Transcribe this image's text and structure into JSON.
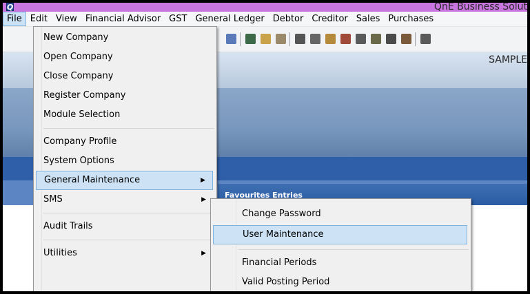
{
  "window": {
    "title": "QnE Business Solut",
    "app_icon_glyph": "Q"
  },
  "menubar": {
    "items": [
      {
        "label": "File",
        "active": true
      },
      {
        "label": "Edit"
      },
      {
        "label": "View"
      },
      {
        "label": "Financial Advisor"
      },
      {
        "label": "GST"
      },
      {
        "label": "General Ledger"
      },
      {
        "label": "Debtor"
      },
      {
        "label": "Creditor"
      },
      {
        "label": "Sales"
      },
      {
        "label": "Purchases"
      }
    ]
  },
  "background": {
    "company_name": "SAMPLE",
    "favourites_label": "Favourites Entries"
  },
  "file_menu": {
    "items": [
      {
        "label": "New Company"
      },
      {
        "label": "Open Company"
      },
      {
        "label": "Close Company"
      },
      {
        "label": "Register Company"
      },
      {
        "label": "Module Selection"
      },
      {
        "label": "Company Profile"
      },
      {
        "label": "System Options"
      },
      {
        "label": "General Maintenance",
        "submenu": true,
        "highlighted": true
      },
      {
        "label": "SMS",
        "submenu": true
      },
      {
        "label": "Audit Trails"
      },
      {
        "label": "Utilities",
        "submenu": true
      }
    ]
  },
  "general_maintenance_menu": {
    "items": [
      {
        "label": "Change Password"
      },
      {
        "label": "User Maintenance",
        "highlighted": true
      },
      {
        "label": "Financial Periods"
      },
      {
        "label": "Valid Posting Period"
      }
    ]
  },
  "colors": {
    "title_bar": "#c975e0",
    "menu_highlight": "#cde3f5",
    "menu_highlight_border": "#7fb2dd",
    "dark_band": "#2e5fa8"
  },
  "icons": {
    "submenu_arrow": "▶"
  }
}
